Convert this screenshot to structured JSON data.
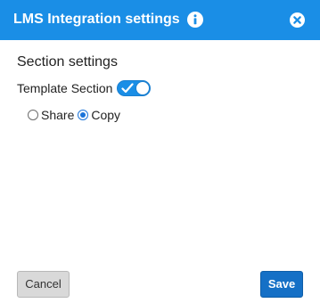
{
  "dialog": {
    "title": "LMS Integration settings",
    "info_icon": "info-circle-icon",
    "close_icon": "close-circle-icon"
  },
  "section": {
    "heading": "Section settings",
    "template_label": "Template Section",
    "template_enabled": true
  },
  "mode": {
    "options": [
      {
        "label": "Share",
        "selected": false
      },
      {
        "label": "Copy",
        "selected": true
      }
    ]
  },
  "footer": {
    "cancel_label": "Cancel",
    "save_label": "Save"
  },
  "colors": {
    "header_bg": "#1a8ee6",
    "accent": "#1570c6"
  }
}
